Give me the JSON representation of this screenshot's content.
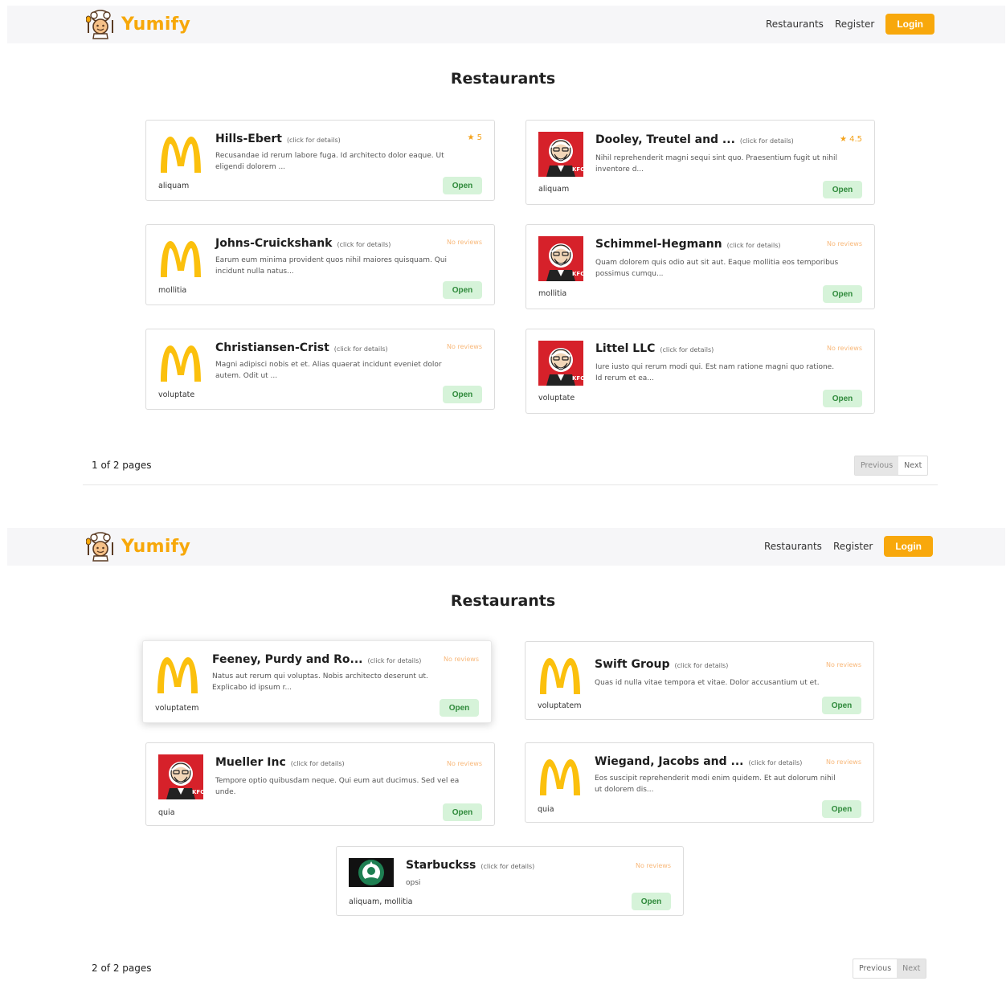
{
  "brand": {
    "name": "Yumify",
    "accent": "#f8a80c"
  },
  "nav": {
    "restaurants": "Restaurants",
    "register": "Register",
    "login": "Login"
  },
  "page_title": "Restaurants",
  "click_hint": "(click for details)",
  "open_label": "Open",
  "pager": {
    "previous": "Previous",
    "next": "Next"
  },
  "screen1": {
    "pages_text": "1 of 2 pages",
    "cards": [
      {
        "name": "Hills-Ebert",
        "logo": "mcdonalds-logo",
        "rating": "5",
        "rated": true,
        "desc": "Recusandae id rerum labore fuga. Id architecto dolor eaque. Ut eligendi dolorem ...",
        "cats": "aliquam"
      },
      {
        "name": "Dooley, Treutel and ...",
        "logo": "kfc-logo",
        "rating": "4.5",
        "rated": true,
        "desc": "Nihil reprehenderit magni sequi sint quo. Praesentium fugit ut nihil inventore d...",
        "cats": "aliquam"
      },
      {
        "name": "Johns-Cruickshank",
        "logo": "mcdonalds-logo",
        "rating": "No reviews",
        "rated": false,
        "desc": "Earum eum minima provident quos nihil maiores quisquam. Qui incidunt nulla natus...",
        "cats": "mollitia"
      },
      {
        "name": "Schimmel-Hegmann",
        "logo": "kfc-logo",
        "rating": "No reviews",
        "rated": false,
        "desc": "Quam dolorem quis odio aut sit aut. Eaque mollitia eos temporibus possimus cumqu...",
        "cats": "mollitia"
      },
      {
        "name": "Christiansen-Crist",
        "logo": "mcdonalds-logo",
        "rating": "No reviews",
        "rated": false,
        "desc": "Magni adipisci nobis et et. Alias quaerat incidunt eveniet dolor autem. Odit ut ...",
        "cats": "voluptate"
      },
      {
        "name": "Littel LLC",
        "logo": "kfc-logo",
        "rating": "No reviews",
        "rated": false,
        "desc": "Iure iusto qui rerum modi qui. Est nam ratione magni quo ratione. Id rerum et ea...",
        "cats": "voluptate"
      }
    ]
  },
  "screen2": {
    "pages_text": "2 of 2 pages",
    "cards": [
      {
        "name": "Feeney, Purdy and Ro...",
        "logo": "mcdonalds-logo",
        "rating": "No reviews",
        "rated": false,
        "desc": "Natus aut rerum qui voluptas. Nobis architecto deserunt ut. Explicabo id ipsum r...",
        "cats": "voluptatem"
      },
      {
        "name": "Swift Group",
        "logo": "mcdonalds-logo",
        "rating": "No reviews",
        "rated": false,
        "desc": "Quas id nulla vitae tempora et vitae. Dolor accusantium ut et.",
        "cats": "voluptatem"
      },
      {
        "name": "Mueller Inc",
        "logo": "kfc-logo",
        "rating": "No reviews",
        "rated": false,
        "desc": "Tempore optio quibusdam neque. Qui eum aut ducimus. Sed vel ea unde.",
        "cats": "quia"
      },
      {
        "name": "Wiegand, Jacobs and ...",
        "logo": "mcdonalds-logo",
        "rating": "No reviews",
        "rated": false,
        "desc": "Eos suscipit reprehenderit modi enim quidem. Et aut dolorum nihil ut dolorem dis...",
        "cats": "quia"
      },
      {
        "name": "Starbuckss",
        "logo": "starbucks-logo",
        "rating": "No reviews",
        "rated": false,
        "desc": "opsi",
        "cats": "aliquam, mollitia"
      }
    ]
  }
}
